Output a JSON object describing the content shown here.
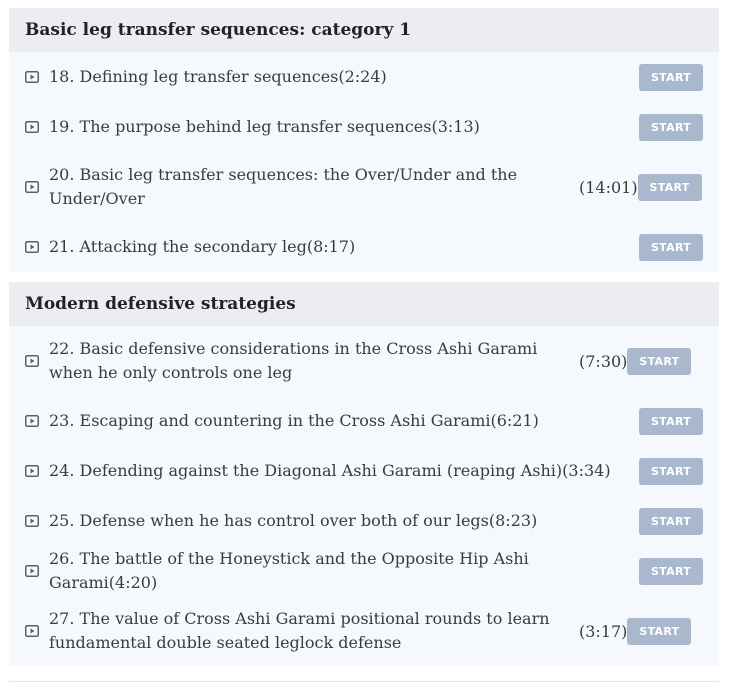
{
  "sections": [
    {
      "title": "Basic leg transfer sequences: category 1",
      "lessons": [
        {
          "text": "18. Defining leg transfer sequences(2:24)",
          "duration": "",
          "button": "START"
        },
        {
          "text": "19. The purpose behind leg transfer sequences(3:13)",
          "duration": "",
          "button": "START"
        },
        {
          "text": "20. Basic leg transfer sequences: the Over/Under and the Under/Over",
          "duration": "(14:01)",
          "button": "START"
        },
        {
          "text": "21. Attacking the secondary leg(8:17)",
          "duration": "",
          "button": "START"
        }
      ]
    },
    {
      "title": "Modern defensive strategies",
      "lessons": [
        {
          "text": "22. Basic defensive considerations in the Cross Ashi Garami when he only controls one leg",
          "duration": "(7:30)",
          "button": "START"
        },
        {
          "text": "23. Escaping and countering in the Cross Ashi Garami(6:21)",
          "duration": "",
          "button": "START"
        },
        {
          "text": "24. Defending against the Diagonal Ashi Garami (reaping Ashi)(3:34)",
          "duration": "",
          "button": "START"
        },
        {
          "text": "25. Defense when he has control over both of our legs(8:23)",
          "duration": "",
          "button": "START"
        },
        {
          "text": "26. The battle of the Honeystick and the Opposite Hip Ashi Garami(4:20)",
          "duration": "",
          "button": "START"
        },
        {
          "text": "27. The value of Cross Ashi Garami positional rounds to learn fundamental double seated leglock defense",
          "duration": "(3:17)",
          "button": "START"
        }
      ]
    }
  ]
}
